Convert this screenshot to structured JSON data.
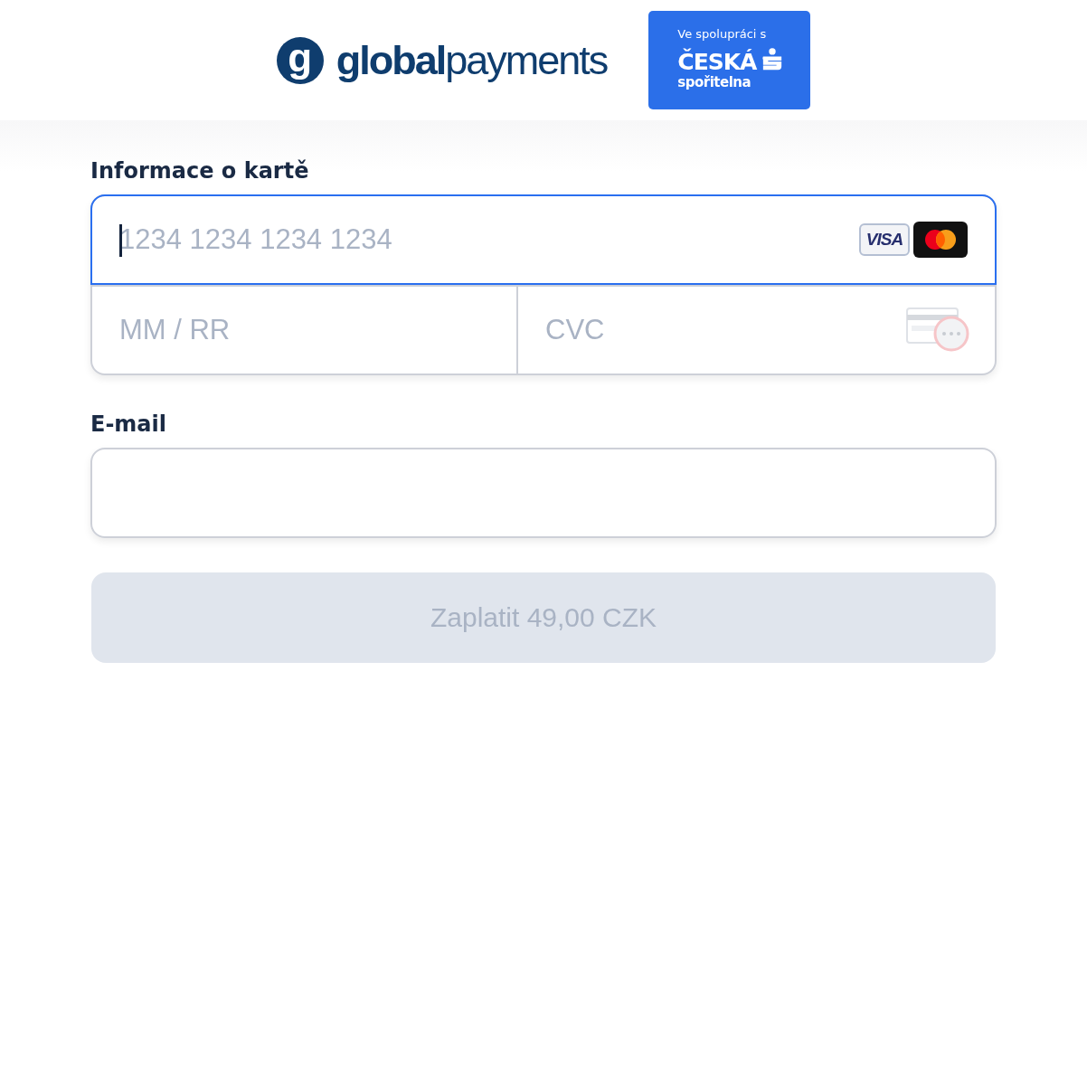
{
  "header": {
    "brand": {
      "mark": "g",
      "name_bold": "global",
      "name_light": "payments"
    },
    "partner": {
      "caption": "Ve spolupráci s",
      "bank_top": "ČESKÁ",
      "bank_bottom": "spořitelna"
    }
  },
  "card_section": {
    "label": "Informace o kartě",
    "card_number": {
      "placeholder": "1234 1234 1234 1234",
      "focused": true
    },
    "card_brands": [
      {
        "kind": "visa",
        "label": "VISA"
      },
      {
        "kind": "mastercard"
      }
    ],
    "expiry": {
      "placeholder": "MM / RR"
    },
    "cvc": {
      "placeholder": "CVC"
    }
  },
  "email": {
    "label": "E-mail"
  },
  "pay_button": {
    "label": "Zaplatit 49,00 CZK",
    "disabled": true
  }
}
